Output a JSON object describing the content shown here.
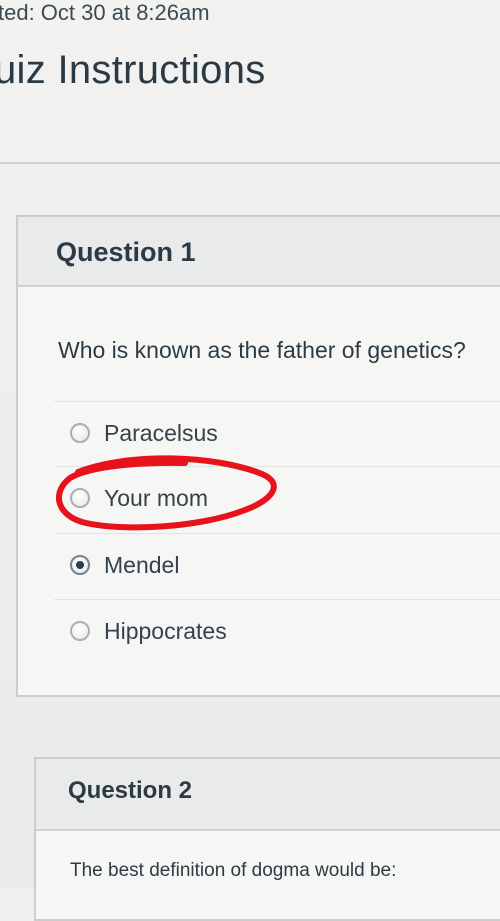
{
  "header": {
    "started_text": "ted: Oct 30 at 8:26am",
    "title": "uiz Instructions"
  },
  "questions": [
    {
      "label": "Question 1",
      "text": "Who is known as the father of genetics?",
      "answers": [
        {
          "label": "Paracelsus",
          "selected": false
        },
        {
          "label": "Your mom",
          "selected": false
        },
        {
          "label": "Mendel",
          "selected": true
        },
        {
          "label": "Hippocrates",
          "selected": false
        }
      ]
    },
    {
      "label": "Question 2",
      "text": "The best definition of dogma would be:"
    }
  ],
  "annotation": {
    "color": "#e8121b",
    "circled_answer": "Your mom"
  },
  "icons": {
    "radio_unselected": "radio-unselected-icon",
    "radio_selected": "radio-selected-icon"
  }
}
